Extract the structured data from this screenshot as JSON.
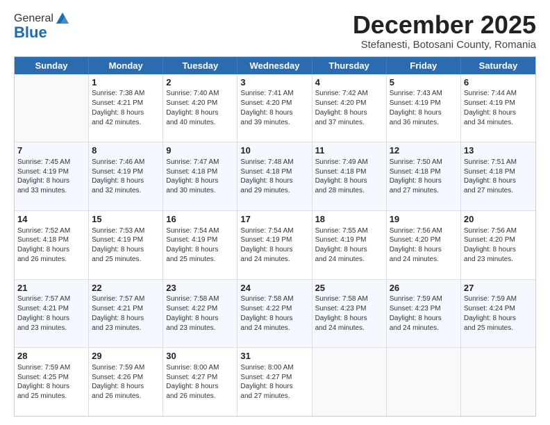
{
  "logo": {
    "general": "General",
    "blue": "Blue"
  },
  "title": "December 2025",
  "subtitle": "Stefanesti, Botosani County, Romania",
  "days": [
    "Sunday",
    "Monday",
    "Tuesday",
    "Wednesday",
    "Thursday",
    "Friday",
    "Saturday"
  ],
  "weeks": [
    [
      {
        "day": "",
        "info": ""
      },
      {
        "day": "1",
        "info": "Sunrise: 7:38 AM\nSunset: 4:21 PM\nDaylight: 8 hours\nand 42 minutes."
      },
      {
        "day": "2",
        "info": "Sunrise: 7:40 AM\nSunset: 4:20 PM\nDaylight: 8 hours\nand 40 minutes."
      },
      {
        "day": "3",
        "info": "Sunrise: 7:41 AM\nSunset: 4:20 PM\nDaylight: 8 hours\nand 39 minutes."
      },
      {
        "day": "4",
        "info": "Sunrise: 7:42 AM\nSunset: 4:20 PM\nDaylight: 8 hours\nand 37 minutes."
      },
      {
        "day": "5",
        "info": "Sunrise: 7:43 AM\nSunset: 4:19 PM\nDaylight: 8 hours\nand 36 minutes."
      },
      {
        "day": "6",
        "info": "Sunrise: 7:44 AM\nSunset: 4:19 PM\nDaylight: 8 hours\nand 34 minutes."
      }
    ],
    [
      {
        "day": "7",
        "info": "Sunrise: 7:45 AM\nSunset: 4:19 PM\nDaylight: 8 hours\nand 33 minutes."
      },
      {
        "day": "8",
        "info": "Sunrise: 7:46 AM\nSunset: 4:19 PM\nDaylight: 8 hours\nand 32 minutes."
      },
      {
        "day": "9",
        "info": "Sunrise: 7:47 AM\nSunset: 4:18 PM\nDaylight: 8 hours\nand 30 minutes."
      },
      {
        "day": "10",
        "info": "Sunrise: 7:48 AM\nSunset: 4:18 PM\nDaylight: 8 hours\nand 29 minutes."
      },
      {
        "day": "11",
        "info": "Sunrise: 7:49 AM\nSunset: 4:18 PM\nDaylight: 8 hours\nand 28 minutes."
      },
      {
        "day": "12",
        "info": "Sunrise: 7:50 AM\nSunset: 4:18 PM\nDaylight: 8 hours\nand 27 minutes."
      },
      {
        "day": "13",
        "info": "Sunrise: 7:51 AM\nSunset: 4:18 PM\nDaylight: 8 hours\nand 27 minutes."
      }
    ],
    [
      {
        "day": "14",
        "info": "Sunrise: 7:52 AM\nSunset: 4:18 PM\nDaylight: 8 hours\nand 26 minutes."
      },
      {
        "day": "15",
        "info": "Sunrise: 7:53 AM\nSunset: 4:19 PM\nDaylight: 8 hours\nand 25 minutes."
      },
      {
        "day": "16",
        "info": "Sunrise: 7:54 AM\nSunset: 4:19 PM\nDaylight: 8 hours\nand 25 minutes."
      },
      {
        "day": "17",
        "info": "Sunrise: 7:54 AM\nSunset: 4:19 PM\nDaylight: 8 hours\nand 24 minutes."
      },
      {
        "day": "18",
        "info": "Sunrise: 7:55 AM\nSunset: 4:19 PM\nDaylight: 8 hours\nand 24 minutes."
      },
      {
        "day": "19",
        "info": "Sunrise: 7:56 AM\nSunset: 4:20 PM\nDaylight: 8 hours\nand 24 minutes."
      },
      {
        "day": "20",
        "info": "Sunrise: 7:56 AM\nSunset: 4:20 PM\nDaylight: 8 hours\nand 23 minutes."
      }
    ],
    [
      {
        "day": "21",
        "info": "Sunrise: 7:57 AM\nSunset: 4:21 PM\nDaylight: 8 hours\nand 23 minutes."
      },
      {
        "day": "22",
        "info": "Sunrise: 7:57 AM\nSunset: 4:21 PM\nDaylight: 8 hours\nand 23 minutes."
      },
      {
        "day": "23",
        "info": "Sunrise: 7:58 AM\nSunset: 4:22 PM\nDaylight: 8 hours\nand 23 minutes."
      },
      {
        "day": "24",
        "info": "Sunrise: 7:58 AM\nSunset: 4:22 PM\nDaylight: 8 hours\nand 24 minutes."
      },
      {
        "day": "25",
        "info": "Sunrise: 7:58 AM\nSunset: 4:23 PM\nDaylight: 8 hours\nand 24 minutes."
      },
      {
        "day": "26",
        "info": "Sunrise: 7:59 AM\nSunset: 4:23 PM\nDaylight: 8 hours\nand 24 minutes."
      },
      {
        "day": "27",
        "info": "Sunrise: 7:59 AM\nSunset: 4:24 PM\nDaylight: 8 hours\nand 25 minutes."
      }
    ],
    [
      {
        "day": "28",
        "info": "Sunrise: 7:59 AM\nSunset: 4:25 PM\nDaylight: 8 hours\nand 25 minutes."
      },
      {
        "day": "29",
        "info": "Sunrise: 7:59 AM\nSunset: 4:26 PM\nDaylight: 8 hours\nand 26 minutes."
      },
      {
        "day": "30",
        "info": "Sunrise: 8:00 AM\nSunset: 4:27 PM\nDaylight: 8 hours\nand 26 minutes."
      },
      {
        "day": "31",
        "info": "Sunrise: 8:00 AM\nSunset: 4:27 PM\nDaylight: 8 hours\nand 27 minutes."
      },
      {
        "day": "",
        "info": ""
      },
      {
        "day": "",
        "info": ""
      },
      {
        "day": "",
        "info": ""
      }
    ]
  ]
}
